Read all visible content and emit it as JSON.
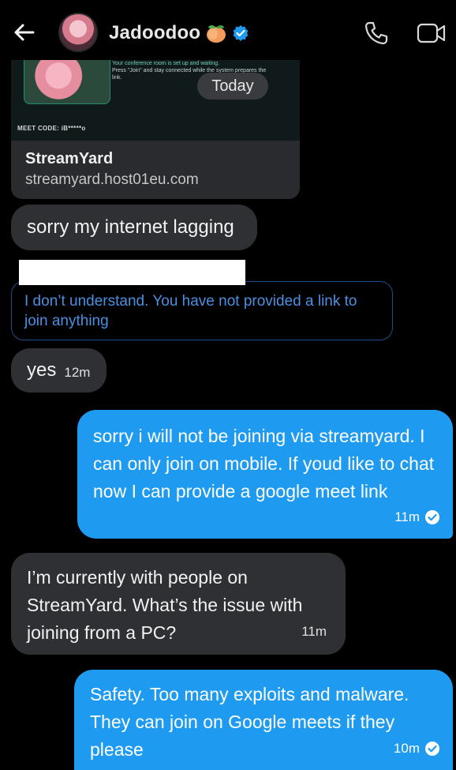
{
  "header": {
    "contact_name": "Jadoodoo",
    "peach_emoji": "🍑",
    "icons": [
      "back-arrow-icon",
      "avatar",
      "peach-icon",
      "verified-icon",
      "phone-icon",
      "video-icon"
    ]
  },
  "link_card": {
    "invite_line1": "Your conference room is set up and waiting.",
    "invite_line2": "Press \"Join\" and stay connected while the system prepares the",
    "invite_line3": "link.",
    "meet_code": "MEET CODE: iB*****o",
    "title": "StreamYard",
    "url": "streamyard.host01eu.com"
  },
  "date_badge": "Today",
  "messages": [
    {
      "direction": "incoming",
      "text": "sorry my internet lagging"
    },
    {
      "direction": "incoming-quoted",
      "text": "I don’t understand. You have not provided a link to join anything"
    },
    {
      "direction": "incoming",
      "text": "yes",
      "time": "12m"
    },
    {
      "direction": "outgoing",
      "text": "sorry i will not be joining via streamyard. I can only join on mobile. If youd like to chat now I can provide a google meet link",
      "time": "11m"
    },
    {
      "direction": "incoming",
      "text": "I’m currently with people on StreamYard. What’s the issue with joining from a PC?",
      "time": "11m"
    },
    {
      "direction": "outgoing",
      "text": "Safety. Too many exploits and malware. They can join on Google meets if they please",
      "time": "10m"
    }
  ],
  "colors": {
    "background": "#000000",
    "incoming_bubble": "#2f3033",
    "outgoing_bubble": "#1e9bf0",
    "quote_text": "#4a90e2",
    "verified": "#1d9bf0"
  }
}
